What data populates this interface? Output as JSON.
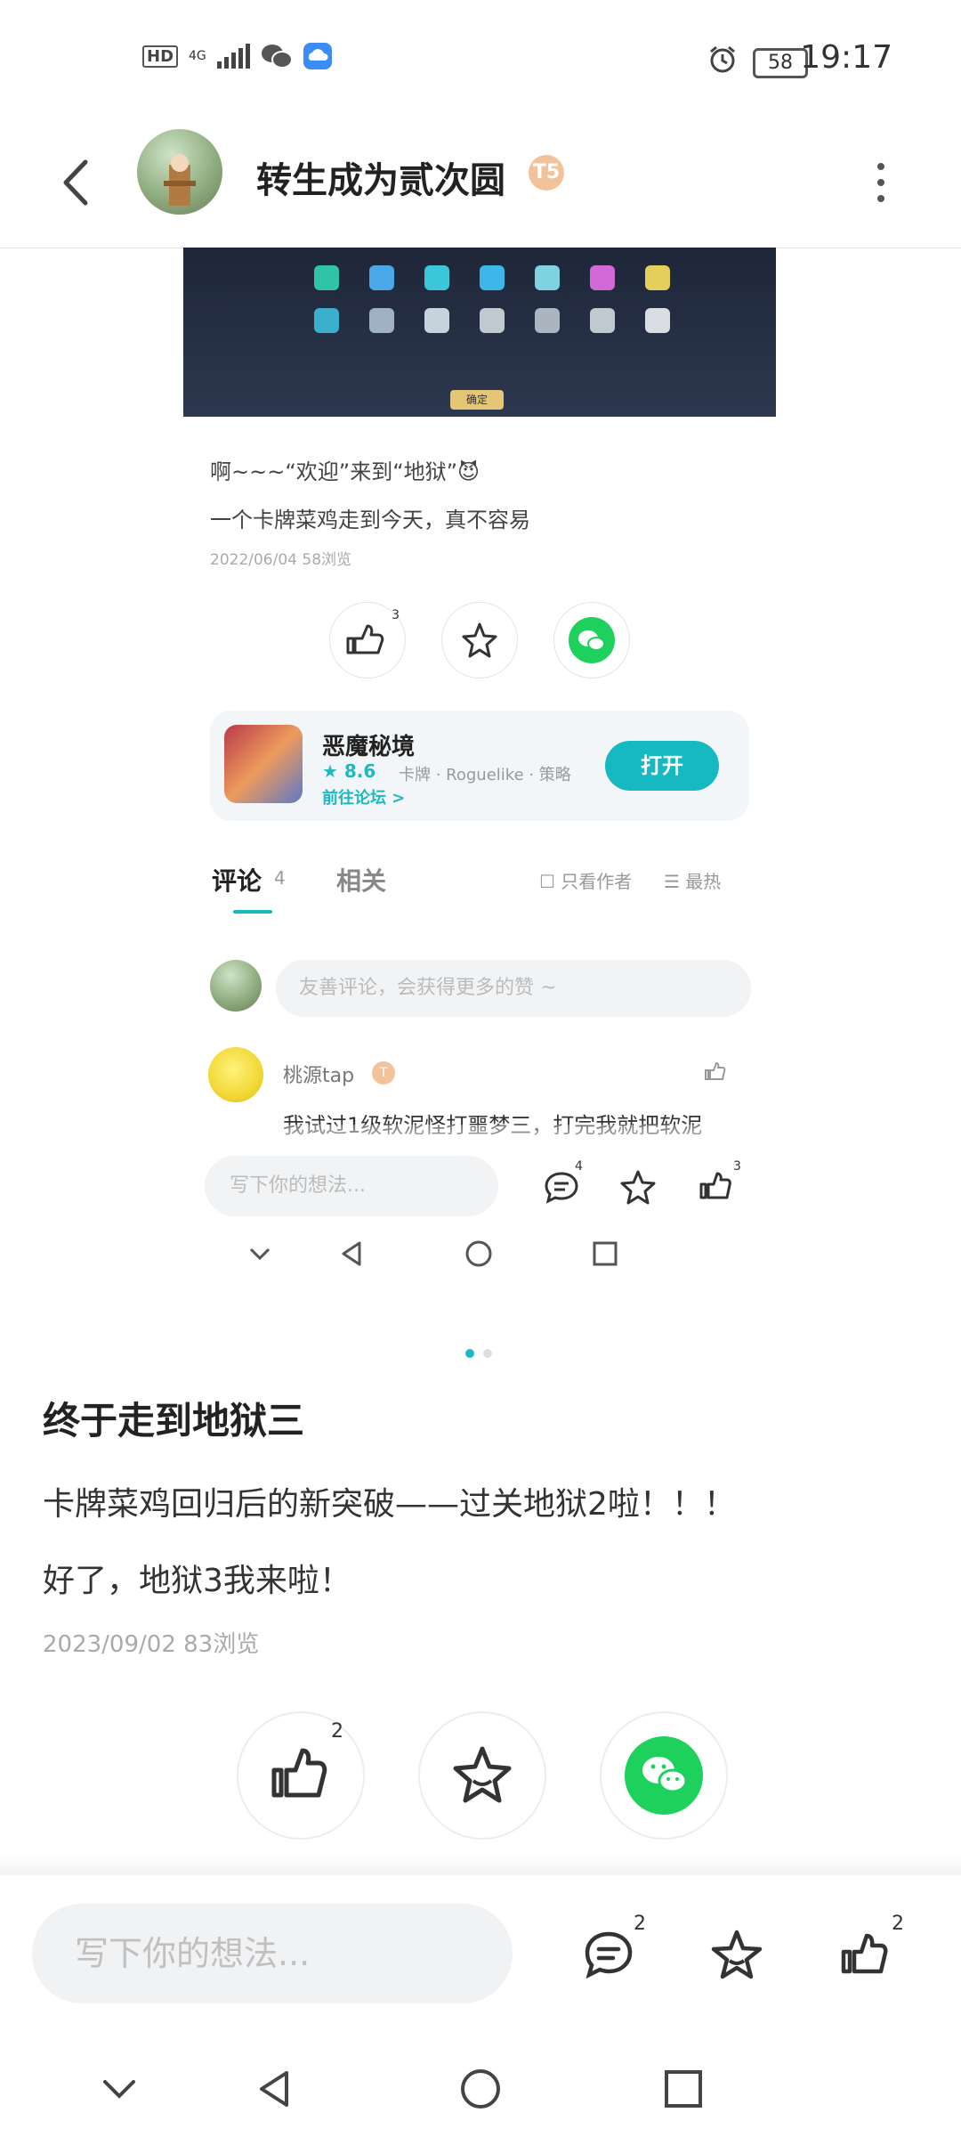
{
  "status_bar": {
    "left_icons": [
      "hd-icon",
      "4g-signal-icon",
      "wechat-icon",
      "cloud-icon"
    ],
    "hd_label": "HD",
    "network_label": "4G",
    "battery": "58",
    "time": "19:17"
  },
  "header": {
    "title": "转生成为贰次圆",
    "badge": "T5"
  },
  "inner_post": {
    "game_ok_label": "确定",
    "text1": "啊~~~“欢迎”来到“地狱”😈",
    "text2": "一个卡牌菜鸡走到今天，真不容易",
    "meta": "2022/06/04  58浏览",
    "like_count": "3",
    "app": {
      "name": "恶魔秘境",
      "rating": "★ 8.6",
      "tags": "卡牌 · Roguelike · 策略",
      "forum_link": "前往论坛 >",
      "open_label": "打开"
    },
    "tabs": {
      "comments_label": "评论",
      "comments_count": "4",
      "related_label": "相关",
      "only_author": "只看作者",
      "sort": "最热"
    },
    "comment_placeholder": "友善评论，会获得更多的赞 ~",
    "comment": {
      "user": "桃源tap",
      "user_badge": "T",
      "text": "我试过1级软泥怪打噩梦三，打完我就把软泥"
    },
    "bottom": {
      "placeholder": "写下你的想法...",
      "comment_count": "4",
      "like_count": "3"
    }
  },
  "carousel": {
    "active_index": 0,
    "count": 2,
    "active_color": "#1fb8c1",
    "inactive_color": "#dddddd"
  },
  "post": {
    "title": "终于走到地狱三",
    "paragraph1": "卡牌菜鸡回归后的新突破——过关地狱2啦！！！",
    "paragraph2": "好了，地狱3我来啦！",
    "meta": "2023/09/02  83浏览",
    "like_count": "2"
  },
  "bottom_bar": {
    "placeholder": "写下你的想法...",
    "comment_count": "2",
    "like_count": "2"
  },
  "colors": {
    "accent": "#16b9c1",
    "wechat_green": "#1ed15c"
  }
}
